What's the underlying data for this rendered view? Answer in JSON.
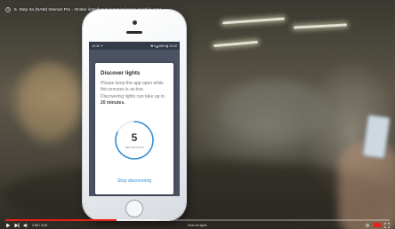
{
  "video": {
    "title": "5. Step 3a (NAM) Interact Pro - Onsite install and commissioning (mobile app)",
    "time": "1:05 / 3:44",
    "chapter": "Scan for lights",
    "progress": 0.29,
    "buffered": 0.4,
    "accent_color": "#e62117"
  },
  "phone_status": {
    "left": "10:32 ✦",
    "right": "✱ ▾◢ 88% ▮ 14:32"
  },
  "dialog": {
    "title": "Discover lights",
    "body_prefix": "Please keep the app open while this process is ac-tive. Discovering lights can take up to ",
    "body_emphasis": "20 minutes.",
    "count": "5",
    "count_caption": "lights discovered",
    "ring_progress": 0.82,
    "ring_color": "#3a8fd0",
    "stop_label": "Stop discovering"
  },
  "icons": {
    "title_icon": "clock-icon",
    "play": "play-icon",
    "next": "next-icon",
    "volume": "volume-icon",
    "settings": "gear-icon",
    "youtube": "youtube-icon",
    "fullscreen": "fullscreen-icon"
  }
}
